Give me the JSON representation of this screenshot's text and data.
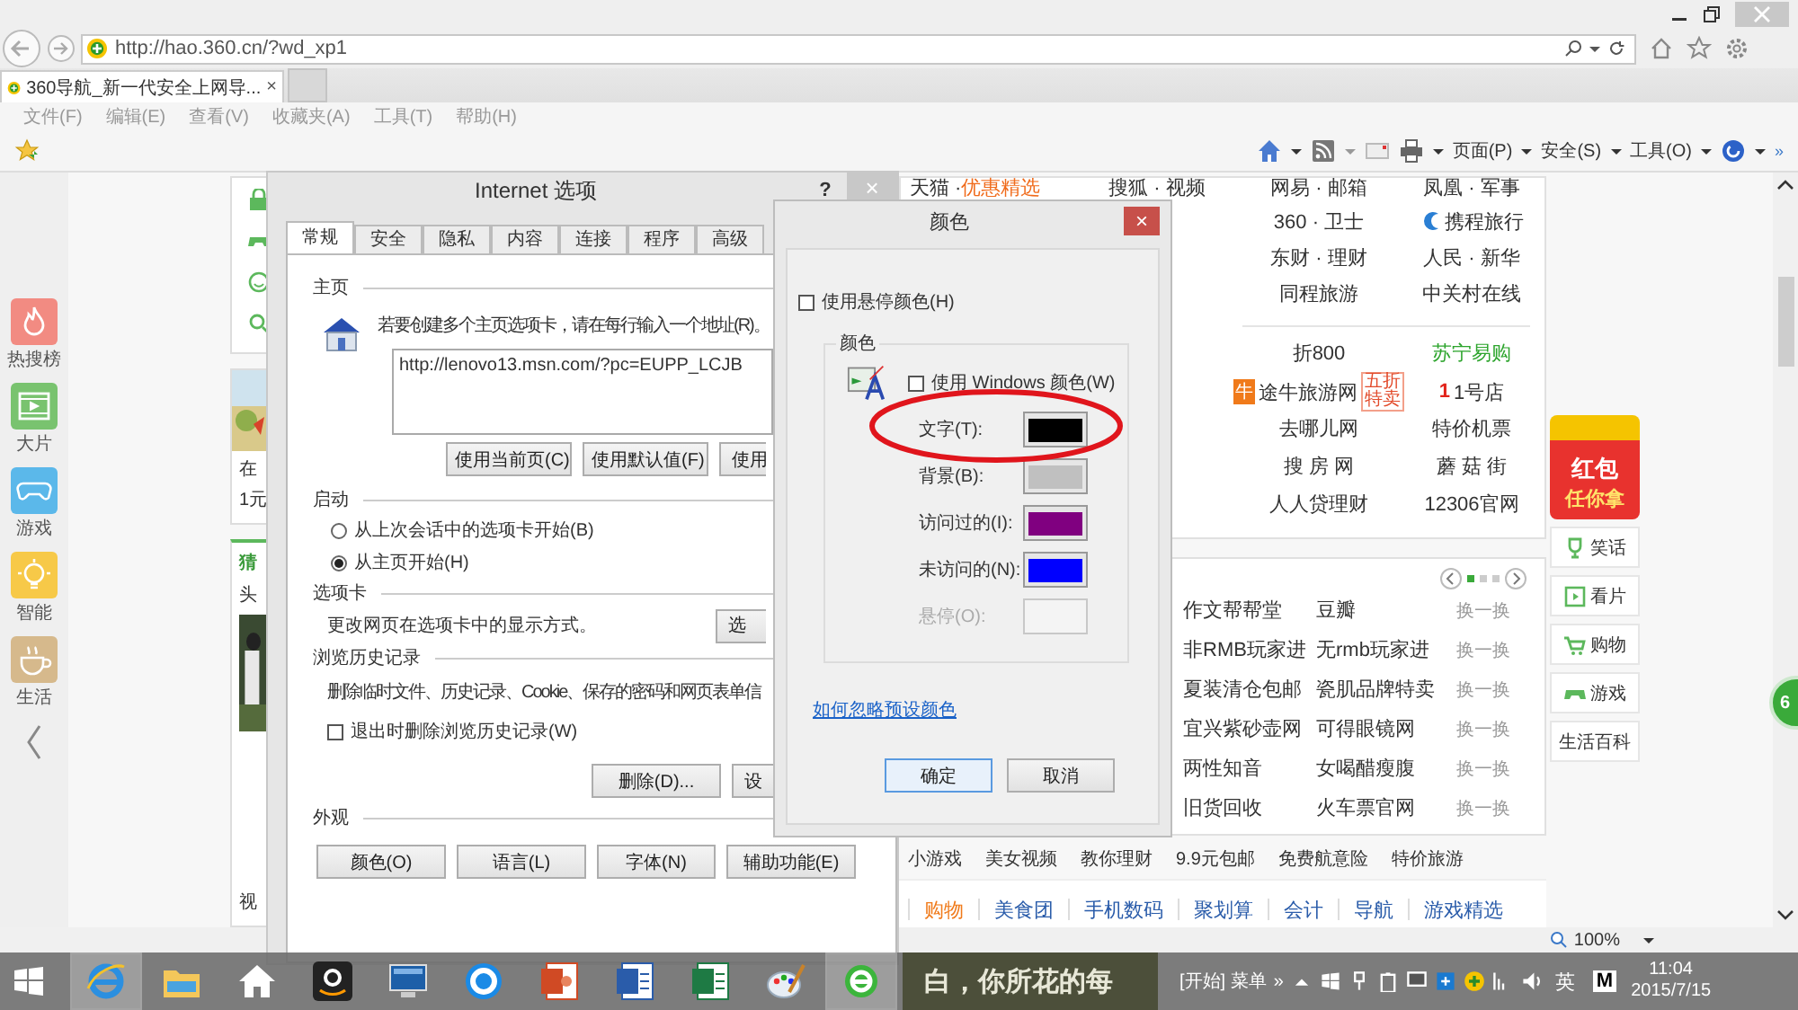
{
  "browser": {
    "address": "http://hao.360.cn/?wd_xp1",
    "tab": "360导航_新一代安全上网导...",
    "tab_close": "×",
    "menu": [
      "文件(F)",
      "编辑(E)",
      "查看(V)",
      "收藏夹(A)",
      "工具(T)",
      "帮助(H)"
    ],
    "commands": [
      "页面(P)",
      "安全(S)",
      "工具(O)"
    ],
    "more": "»"
  },
  "nav": [
    {
      "label": "热搜榜",
      "kind": "flame",
      "color": "#f28b82"
    },
    {
      "label": "大片",
      "kind": "film",
      "color": "#79c36f"
    },
    {
      "label": "游戏",
      "kind": "gamepad",
      "color": "#5bb8ea"
    },
    {
      "label": "智能",
      "kind": "bulb",
      "color": "#f7c948"
    },
    {
      "label": "生活",
      "kind": "cup",
      "color": "#d6b98c"
    }
  ],
  "fragments": [
    "在",
    "1元",
    "猜",
    "头",
    "视"
  ],
  "top_links": [
    [
      {
        "text": "天猫 ·",
        "promo": "优惠精选"
      },
      {
        "text": "搜狐 · 视频"
      },
      {
        "text": "网易 · 邮箱"
      },
      {
        "text": "凤凰 · 军事"
      }
    ],
    [
      {
        "text": "360 · 卫士"
      },
      {
        "text": "携程旅行",
        "kind": "bird"
      }
    ],
    [
      {
        "text": "东财 · 理财"
      },
      {
        "text": "人民 · 新华"
      }
    ],
    [
      {
        "text": "同程旅游"
      },
      {
        "text": "中关村在线"
      }
    ]
  ],
  "shop_links": [
    [
      {
        "text": "折800",
        "highlight": false
      },
      {
        "text": "苏宁易购",
        "highlight": true
      }
    ],
    [
      {
        "text": "途牛旅游网",
        "highlight": false,
        "logo": "牛",
        "badge": "五折特卖"
      },
      {
        "text": "1号店",
        "highlight": false,
        "logo": "1"
      }
    ],
    [
      {
        "text": "去哪儿网",
        "highlight": false
      },
      {
        "text": "特价机票",
        "highlight": false
      }
    ],
    [
      {
        "text": "搜 房 网",
        "highlight": false
      },
      {
        "text": "蘑 菇 街",
        "highlight": false
      }
    ],
    [
      {
        "text": "人人贷理财",
        "highlight": false
      },
      {
        "text": "12306官网",
        "highlight": false
      }
    ]
  ],
  "pager": [
    {
      "selected": true
    },
    {
      "selected": false
    },
    {
      "selected": false
    }
  ],
  "hot_rows": [
    {
      "a": "作文帮帮堂",
      "b": "豆瓣",
      "swap": "换一换"
    },
    {
      "a": "非RMB玩家进",
      "b": "无rmb玩家进",
      "swap": "换一换"
    },
    {
      "a": "夏装清仓包邮",
      "b": "瓷肌品牌特卖",
      "swap": "换一换"
    },
    {
      "a": "宜兴紫砂壶网",
      "b": "可得眼镜网",
      "swap": "换一换"
    },
    {
      "a": "两性知音",
      "b": "女喝醋瘦腹",
      "swap": "换一换"
    },
    {
      "a": "旧货回收",
      "b": "火车票官网",
      "swap": "换一换"
    }
  ],
  "strip": [
    "小游戏",
    "美女视频",
    "教你理财",
    "9.9元包邮",
    "免费航意险",
    "特价旅游"
  ],
  "categories": [
    {
      "label": "购物",
      "selected": true
    },
    {
      "label": "美食团",
      "selected": false
    },
    {
      "label": "手机数码",
      "selected": false
    },
    {
      "label": "聚划算",
      "selected": false
    },
    {
      "label": "会计",
      "selected": false
    },
    {
      "label": "导航",
      "selected": false
    },
    {
      "label": "游戏精选",
      "selected": false
    }
  ],
  "promo": {
    "line1": "红包",
    "line2": "任你拿"
  },
  "rail": [
    {
      "label": "笑话",
      "kind": "trophy"
    },
    {
      "label": "看片",
      "kind": "film"
    },
    {
      "label": "购物",
      "kind": "cart"
    },
    {
      "label": "游戏",
      "kind": "gamepad"
    },
    {
      "label": "生活百科",
      "kind": "none"
    }
  ],
  "float_badge": "6",
  "zoom": "100%",
  "internet_options": {
    "title": "Internet 选项",
    "help": "?",
    "close": "×",
    "tabs": [
      {
        "label": "常规",
        "selected": true
      },
      {
        "label": "安全",
        "selected": false
      },
      {
        "label": "隐私",
        "selected": false
      },
      {
        "label": "内容",
        "selected": false
      },
      {
        "label": "连接",
        "selected": false
      },
      {
        "label": "程序",
        "selected": false
      },
      {
        "label": "高级",
        "selected": false
      }
    ],
    "home": {
      "heading": "主页",
      "hint": "若要创建多个主页选项卡，请在每行输入一个地址(R)。",
      "value": "http://lenovo13.msn.com/?pc=EUPP_LCJB",
      "buttons": [
        "使用当前页(C)",
        "使用默认值(F)",
        "使用"
      ]
    },
    "startup": {
      "heading": "启动",
      "options": [
        {
          "label": "从上次会话中的选项卡开始(B)",
          "selected": false
        },
        {
          "label": "从主页开始(H)",
          "selected": true
        }
      ]
    },
    "tab_section": {
      "heading": "选项卡",
      "text": "更改网页在选项卡中的显示方式。",
      "button": "选"
    },
    "history": {
      "heading": "浏览历史记录",
      "text": "删除临时文件、历史记录、Cookie、保存的密码和网页表单信",
      "checkbox": {
        "label": "退出时删除浏览历史记录(W)",
        "checked": false
      },
      "buttons": [
        "删除(D)...",
        "设"
      ]
    },
    "appearance": {
      "heading": "外观",
      "buttons": [
        "颜色(O)",
        "语言(L)",
        "字体(N)",
        "辅助功能(E)"
      ]
    }
  },
  "colors_dialog": {
    "title": "颜色",
    "close": "×",
    "hover_check": {
      "label": "使用悬停颜色(H)",
      "checked": false
    },
    "group": "颜色",
    "windows_check": {
      "label": "使用 Windows 颜色(W)",
      "checked": false
    },
    "rows": [
      {
        "label": "文字(T):",
        "color": "#000000",
        "disabled": false
      },
      {
        "label": "背景(B):",
        "color": "#c0c0c0",
        "disabled": false
      },
      {
        "label": "访问过的(I):",
        "color": "#800080",
        "disabled": false
      },
      {
        "label": "未访问的(N):",
        "color": "#0000ff",
        "disabled": false
      },
      {
        "label": "悬停(O):",
        "disabled": true
      }
    ],
    "link": "如何忽略预设颜色",
    "buttons": [
      {
        "label": "确定",
        "default": true
      },
      {
        "label": "取消",
        "default": false
      }
    ]
  },
  "taskbar": {
    "apps": [
      {
        "kind": "ie",
        "active": true
      },
      {
        "kind": "folder",
        "active": false
      },
      {
        "kind": "home",
        "active": false
      },
      {
        "kind": "amazon",
        "active": false
      },
      {
        "kind": "monitor",
        "active": false
      },
      {
        "kind": "kcircle",
        "active": false
      },
      {
        "kind": "ppt",
        "active": false
      },
      {
        "kind": "word",
        "active": false
      },
      {
        "kind": "excel",
        "active": false
      },
      {
        "kind": "paint",
        "active": false
      },
      {
        "kind": "green",
        "active": true
      }
    ],
    "banner": "白，你所花的每",
    "start_menu": "[开始] 菜单",
    "chevron": "»",
    "ime": "英",
    "m": "M",
    "time": "11:04",
    "date": "2015/7/15"
  }
}
